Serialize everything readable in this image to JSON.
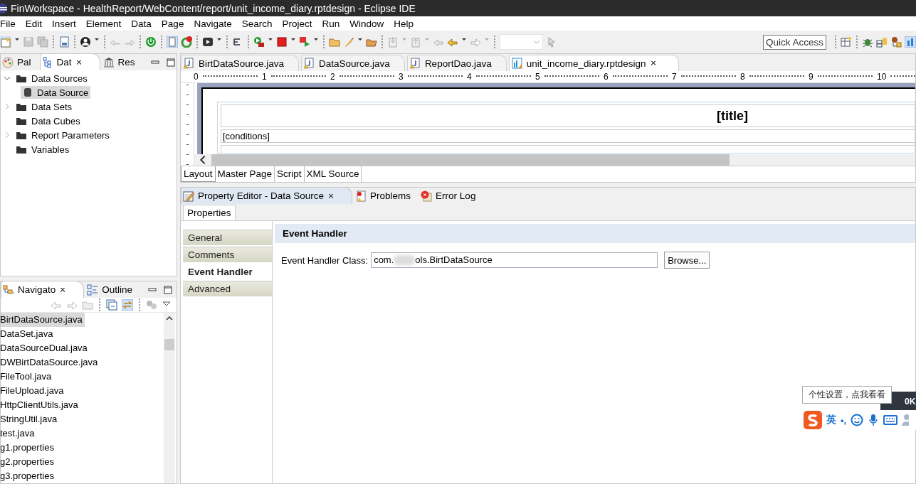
{
  "window": {
    "title": "FinWorkspace - HealthReport/WebContent/report/unit_income_diary.rptdesign - Eclipse IDE"
  },
  "menu": [
    "File",
    "Edit",
    "Insert",
    "Element",
    "Data",
    "Page",
    "Navigate",
    "Search",
    "Project",
    "Run",
    "Window",
    "Help"
  ],
  "toolbar": {
    "quick_access": "Quick Access"
  },
  "data_view": {
    "tabs": [
      {
        "label": "Pal",
        "selected": false,
        "closable": false
      },
      {
        "label": "Dat",
        "selected": true,
        "closable": true
      },
      {
        "label": "Res",
        "selected": false,
        "closable": false
      }
    ],
    "tree": [
      {
        "label": "Data Sources",
        "kind": "folder",
        "expanded": true,
        "selected": false,
        "children": [
          {
            "label": "Data Source",
            "kind": "source",
            "selected": true
          }
        ]
      },
      {
        "label": "Data Sets",
        "kind": "folder",
        "expanded": false,
        "selected": false
      },
      {
        "label": "Data Cubes",
        "kind": "leaf-folder",
        "selected": false
      },
      {
        "label": "Report Parameters",
        "kind": "folder",
        "expanded": false,
        "selected": false
      },
      {
        "label": "Variables",
        "kind": "leaf-folder",
        "selected": false
      }
    ]
  },
  "navigator": {
    "tabs": [
      {
        "label": "Navigato",
        "selected": true,
        "closable": true
      },
      {
        "label": "Outline",
        "selected": false,
        "closable": false
      }
    ],
    "files": [
      {
        "name": "BirtDataSource.java",
        "selected": true
      },
      {
        "name": "DataSet.java",
        "selected": false
      },
      {
        "name": "DataSourceDual.java",
        "selected": false
      },
      {
        "name": "DWBirtDataSource.java",
        "selected": false
      },
      {
        "name": "FileTool.java",
        "selected": false
      },
      {
        "name": "FileUpload.java",
        "selected": false
      },
      {
        "name": "HttpClientUtils.java",
        "selected": false
      },
      {
        "name": "StringUtil.java",
        "selected": false
      },
      {
        "name": "test.java",
        "selected": false
      },
      {
        "name": "g1.properties",
        "selected": false
      },
      {
        "name": "g2.properties",
        "selected": false
      },
      {
        "name": "g3.properties",
        "selected": false
      }
    ]
  },
  "editor": {
    "tabs": [
      {
        "label": "BirtDataSource.java",
        "kind": "java",
        "selected": false
      },
      {
        "label": "DataSource.java",
        "kind": "java",
        "selected": false
      },
      {
        "label": "ReportDao.java",
        "kind": "java",
        "selected": false
      },
      {
        "label": "unit_income_diary.rptdesign",
        "kind": "report",
        "selected": true
      }
    ],
    "ruler": [
      "0",
      "1",
      "2",
      "3",
      "4",
      "5",
      "6",
      "7",
      "8",
      "9",
      "10"
    ],
    "report": {
      "title": "[title]",
      "conditions": "[conditions]"
    },
    "bottom_tabs": [
      {
        "label": "Layout",
        "selected": true
      },
      {
        "label": "Master Page",
        "selected": false
      },
      {
        "label": "Script",
        "selected": false
      },
      {
        "label": "XML Source",
        "selected": false
      }
    ]
  },
  "property_view": {
    "tabs": [
      {
        "label": "Property Editor - Data Source",
        "kind": "property",
        "selected": true
      },
      {
        "label": "Problems",
        "kind": "problems",
        "selected": false
      },
      {
        "label": "Error Log",
        "kind": "errorlog",
        "selected": false
      }
    ],
    "subtab": "Properties",
    "categories": [
      {
        "label": "General",
        "selected": false
      },
      {
        "label": "Comments",
        "selected": false
      },
      {
        "label": "Event Handler",
        "selected": true
      },
      {
        "label": "Advanced",
        "selected": false
      }
    ],
    "section": "Event Handler",
    "field_label": "Event Handler Class:",
    "field_value_start": "com.",
    "field_value_end": "ols.BirtDataSource",
    "browse_button": "Browse..."
  },
  "ime": {
    "tooltip": "个性设置，点我看看",
    "mode": "英",
    "punct": "•,",
    "speed": "0K"
  }
}
